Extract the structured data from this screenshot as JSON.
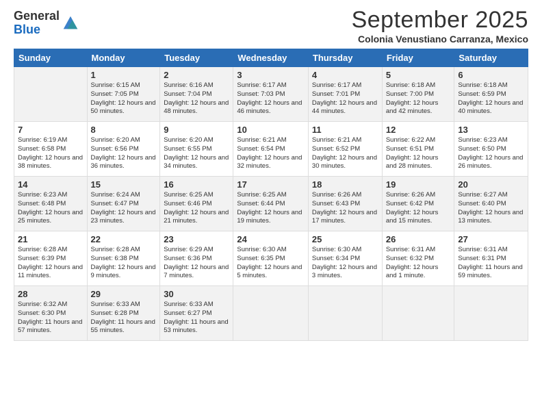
{
  "logo": {
    "general": "General",
    "blue": "Blue"
  },
  "title": "September 2025",
  "location": "Colonia Venustiano Carranza, Mexico",
  "days_of_week": [
    "Sunday",
    "Monday",
    "Tuesday",
    "Wednesday",
    "Thursday",
    "Friday",
    "Saturday"
  ],
  "weeks": [
    [
      {
        "day": "",
        "info": ""
      },
      {
        "day": "1",
        "info": "Sunrise: 6:15 AM\nSunset: 7:05 PM\nDaylight: 12 hours\nand 50 minutes."
      },
      {
        "day": "2",
        "info": "Sunrise: 6:16 AM\nSunset: 7:04 PM\nDaylight: 12 hours\nand 48 minutes."
      },
      {
        "day": "3",
        "info": "Sunrise: 6:17 AM\nSunset: 7:03 PM\nDaylight: 12 hours\nand 46 minutes."
      },
      {
        "day": "4",
        "info": "Sunrise: 6:17 AM\nSunset: 7:01 PM\nDaylight: 12 hours\nand 44 minutes."
      },
      {
        "day": "5",
        "info": "Sunrise: 6:18 AM\nSunset: 7:00 PM\nDaylight: 12 hours\nand 42 minutes."
      },
      {
        "day": "6",
        "info": "Sunrise: 6:18 AM\nSunset: 6:59 PM\nDaylight: 12 hours\nand 40 minutes."
      }
    ],
    [
      {
        "day": "7",
        "info": "Sunrise: 6:19 AM\nSunset: 6:58 PM\nDaylight: 12 hours\nand 38 minutes."
      },
      {
        "day": "8",
        "info": "Sunrise: 6:20 AM\nSunset: 6:56 PM\nDaylight: 12 hours\nand 36 minutes."
      },
      {
        "day": "9",
        "info": "Sunrise: 6:20 AM\nSunset: 6:55 PM\nDaylight: 12 hours\nand 34 minutes."
      },
      {
        "day": "10",
        "info": "Sunrise: 6:21 AM\nSunset: 6:54 PM\nDaylight: 12 hours\nand 32 minutes."
      },
      {
        "day": "11",
        "info": "Sunrise: 6:21 AM\nSunset: 6:52 PM\nDaylight: 12 hours\nand 30 minutes."
      },
      {
        "day": "12",
        "info": "Sunrise: 6:22 AM\nSunset: 6:51 PM\nDaylight: 12 hours\nand 28 minutes."
      },
      {
        "day": "13",
        "info": "Sunrise: 6:23 AM\nSunset: 6:50 PM\nDaylight: 12 hours\nand 26 minutes."
      }
    ],
    [
      {
        "day": "14",
        "info": "Sunrise: 6:23 AM\nSunset: 6:48 PM\nDaylight: 12 hours\nand 25 minutes."
      },
      {
        "day": "15",
        "info": "Sunrise: 6:24 AM\nSunset: 6:47 PM\nDaylight: 12 hours\nand 23 minutes."
      },
      {
        "day": "16",
        "info": "Sunrise: 6:25 AM\nSunset: 6:46 PM\nDaylight: 12 hours\nand 21 minutes."
      },
      {
        "day": "17",
        "info": "Sunrise: 6:25 AM\nSunset: 6:44 PM\nDaylight: 12 hours\nand 19 minutes."
      },
      {
        "day": "18",
        "info": "Sunrise: 6:26 AM\nSunset: 6:43 PM\nDaylight: 12 hours\nand 17 minutes."
      },
      {
        "day": "19",
        "info": "Sunrise: 6:26 AM\nSunset: 6:42 PM\nDaylight: 12 hours\nand 15 minutes."
      },
      {
        "day": "20",
        "info": "Sunrise: 6:27 AM\nSunset: 6:40 PM\nDaylight: 12 hours\nand 13 minutes."
      }
    ],
    [
      {
        "day": "21",
        "info": "Sunrise: 6:28 AM\nSunset: 6:39 PM\nDaylight: 12 hours\nand 11 minutes."
      },
      {
        "day": "22",
        "info": "Sunrise: 6:28 AM\nSunset: 6:38 PM\nDaylight: 12 hours\nand 9 minutes."
      },
      {
        "day": "23",
        "info": "Sunrise: 6:29 AM\nSunset: 6:36 PM\nDaylight: 12 hours\nand 7 minutes."
      },
      {
        "day": "24",
        "info": "Sunrise: 6:30 AM\nSunset: 6:35 PM\nDaylight: 12 hours\nand 5 minutes."
      },
      {
        "day": "25",
        "info": "Sunrise: 6:30 AM\nSunset: 6:34 PM\nDaylight: 12 hours\nand 3 minutes."
      },
      {
        "day": "26",
        "info": "Sunrise: 6:31 AM\nSunset: 6:32 PM\nDaylight: 12 hours\nand 1 minute."
      },
      {
        "day": "27",
        "info": "Sunrise: 6:31 AM\nSunset: 6:31 PM\nDaylight: 11 hours\nand 59 minutes."
      }
    ],
    [
      {
        "day": "28",
        "info": "Sunrise: 6:32 AM\nSunset: 6:30 PM\nDaylight: 11 hours\nand 57 minutes."
      },
      {
        "day": "29",
        "info": "Sunrise: 6:33 AM\nSunset: 6:28 PM\nDaylight: 11 hours\nand 55 minutes."
      },
      {
        "day": "30",
        "info": "Sunrise: 6:33 AM\nSunset: 6:27 PM\nDaylight: 11 hours\nand 53 minutes."
      },
      {
        "day": "",
        "info": ""
      },
      {
        "day": "",
        "info": ""
      },
      {
        "day": "",
        "info": ""
      },
      {
        "day": "",
        "info": ""
      }
    ]
  ]
}
